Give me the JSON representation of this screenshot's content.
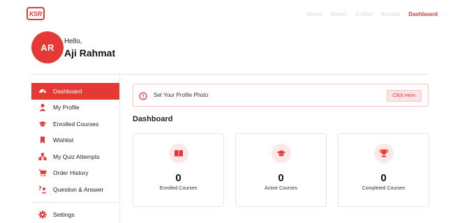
{
  "header": {
    "logo_text": "KSR",
    "nav": [
      {
        "label": "Home",
        "active": false
      },
      {
        "label": "Materi",
        "active": false
      },
      {
        "label": "Artikel",
        "active": false
      },
      {
        "label": "Kontak",
        "active": false
      },
      {
        "label": "Dashboard",
        "active": true
      }
    ]
  },
  "profile": {
    "initials": "AR",
    "greeting": "Hello,",
    "name": "Aji Rahmat"
  },
  "sidebar": {
    "items": [
      {
        "label": "Dashboard",
        "icon": "gauge-icon",
        "active": true
      },
      {
        "label": "My Profile",
        "icon": "user-icon",
        "active": false
      },
      {
        "label": "Enrolled Courses",
        "icon": "graduation-cap-icon",
        "active": false
      },
      {
        "label": "Wishlist",
        "icon": "bookmark-icon",
        "active": false
      },
      {
        "label": "My Quiz Attempts",
        "icon": "quiz-icon",
        "active": false
      },
      {
        "label": "Order History",
        "icon": "cart-icon",
        "active": false
      },
      {
        "label": "Question & Answer",
        "icon": "question-answer-icon",
        "active": false
      }
    ],
    "settings": {
      "label": "Settings",
      "icon": "gear-icon"
    }
  },
  "alert": {
    "text": "Set Your Profile Photo",
    "button": "Click Here"
  },
  "main": {
    "title": "Dashboard",
    "cards": [
      {
        "value": "0",
        "label": "Enrolled Courses",
        "icon": "book-icon"
      },
      {
        "value": "0",
        "label": "Active Courses",
        "icon": "graduation-cap-icon"
      },
      {
        "value": "0",
        "label": "Completed Courses",
        "icon": "trophy-icon"
      }
    ]
  },
  "colors": {
    "accent": "#e53935",
    "accent_light": "#fde8e8",
    "border": "#e6e6e6"
  }
}
